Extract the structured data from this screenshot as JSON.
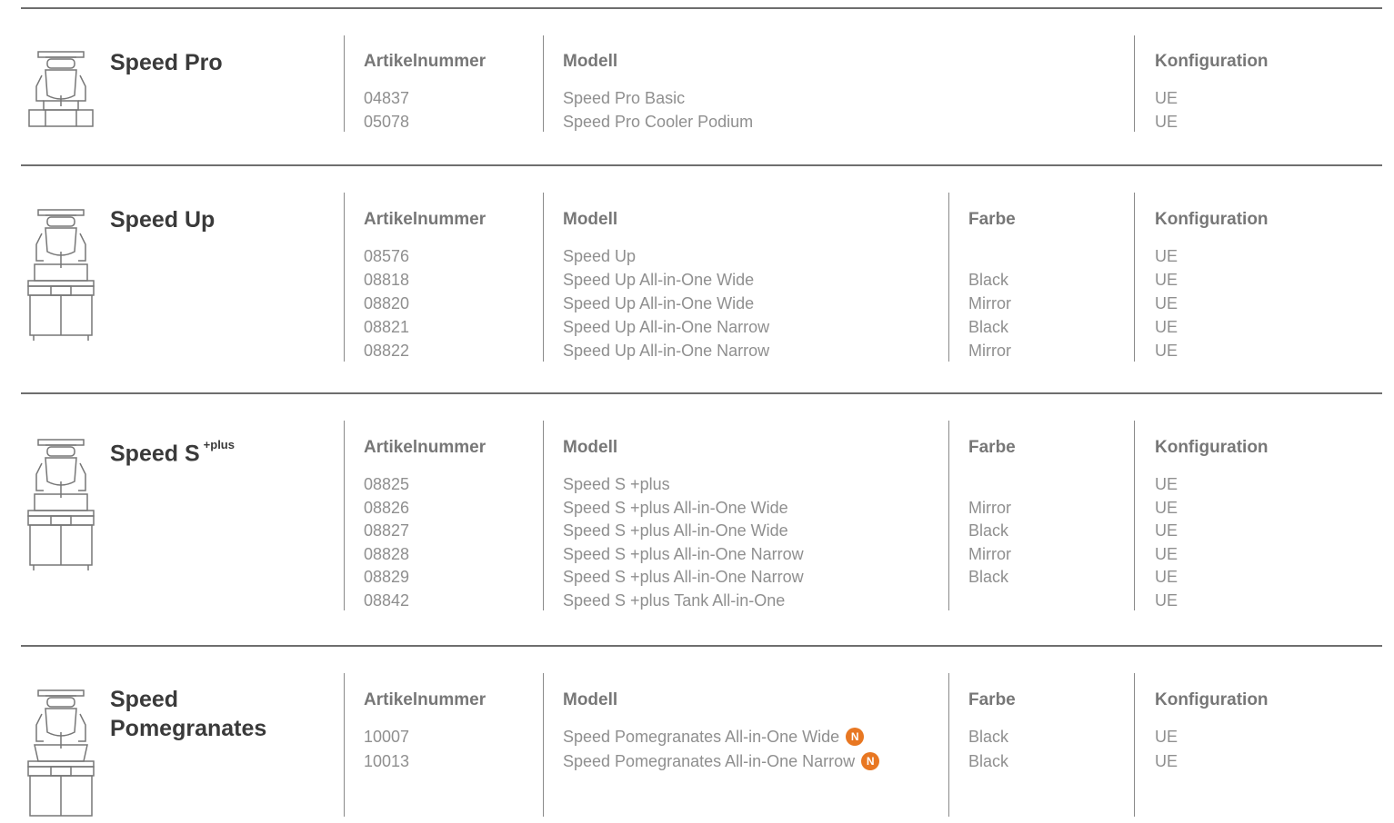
{
  "headers": {
    "art": "Artikelnummer",
    "modell": "Modell",
    "farbe": "Farbe",
    "konf": "Konfiguration"
  },
  "sections": [
    {
      "title": "Speed Pro",
      "rows": [
        {
          "art": "04837",
          "modell": "Speed Pro Basic",
          "farbe": "",
          "konf": "UE"
        },
        {
          "art": "05078",
          "modell": "Speed Pro Cooler Podium",
          "farbe": "",
          "konf": "UE"
        }
      ]
    },
    {
      "title": "Speed Up",
      "rows": [
        {
          "art": "08576",
          "modell": "Speed Up",
          "farbe": "",
          "konf": "UE"
        },
        {
          "art": "08818",
          "modell": "Speed Up All-in-One Wide",
          "farbe": "Black",
          "konf": "UE"
        },
        {
          "art": "08820",
          "modell": "Speed Up All-in-One Wide",
          "farbe": "Mirror",
          "konf": "UE"
        },
        {
          "art": "08821",
          "modell": "Speed Up All-in-One Narrow",
          "farbe": "Black",
          "konf": "UE"
        },
        {
          "art": "08822",
          "modell": "Speed Up All-in-One Narrow",
          "farbe": "Mirror",
          "konf": "UE"
        }
      ]
    },
    {
      "title": "Speed S",
      "title_sup": "+plus",
      "rows": [
        {
          "art": "08825",
          "modell": "Speed S +plus",
          "farbe": "",
          "konf": "UE"
        },
        {
          "art": "08826",
          "modell": "Speed S +plus All-in-One Wide",
          "farbe": "Mirror",
          "konf": "UE"
        },
        {
          "art": "08827",
          "modell": "Speed S +plus All-in-One Wide",
          "farbe": "Black",
          "konf": "UE"
        },
        {
          "art": "08828",
          "modell": "Speed S +plus All-in-One Narrow",
          "farbe": "Mirror",
          "konf": "UE"
        },
        {
          "art": "08829",
          "modell": "Speed S +plus All-in-One Narrow",
          "farbe": "Black",
          "konf": "UE"
        },
        {
          "art": "08842",
          "modell": "Speed S +plus Tank All-in-One",
          "farbe": "",
          "konf": "UE"
        }
      ]
    },
    {
      "title_line1": "Speed",
      "title_line2": "Pomegranates",
      "rows": [
        {
          "art": "10007",
          "modell": "Speed Pomegranates All-in-One Wide",
          "badge": "N",
          "farbe": "Black",
          "konf": "UE"
        },
        {
          "art": "10013",
          "modell": "Speed Pomegranates All-in-One Narrow",
          "badge": "N",
          "farbe": "Black",
          "konf": "UE"
        }
      ]
    }
  ],
  "colors": {
    "rule": "#6e6e6e",
    "title": "#3a3a3a",
    "text": "#8f8f8f",
    "badge": "#e87722"
  },
  "icons": [
    "juicer-countertop-icon",
    "juicer-cabinet-icon",
    "juicer-cabinet-icon",
    "juicer-cabinet-icon"
  ]
}
